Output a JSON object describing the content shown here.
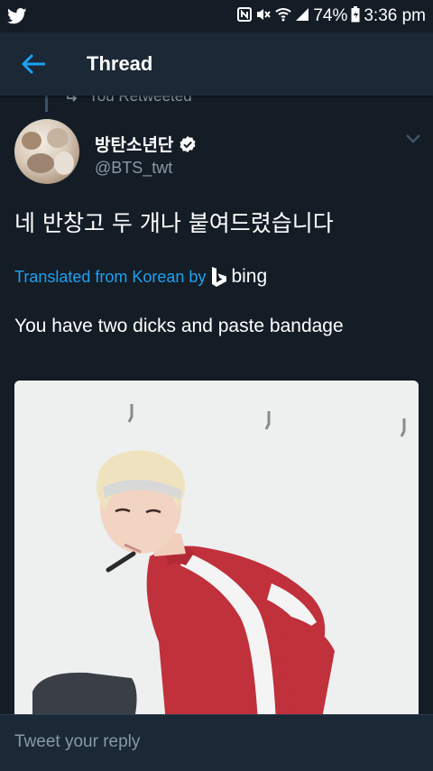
{
  "status_bar": {
    "battery": "74%",
    "time": "3:36 pm"
  },
  "header": {
    "title": "Thread"
  },
  "retweet": {
    "label": "You Retweeted"
  },
  "tweet": {
    "author_name": "방탄소년단",
    "author_handle": "@BTS_twt",
    "text": "네 반창고 두 개나 붙여드렸습니다",
    "translated_label": "Translated from Korean by",
    "translator_name": "bing",
    "translation": "You have two dicks and paste bandage"
  },
  "reply": {
    "placeholder": "Tweet your reply"
  },
  "colors": {
    "background": "#141d26",
    "header": "#1b2836",
    "accent": "#1da1f2",
    "secondary_text": "#8899a6"
  }
}
